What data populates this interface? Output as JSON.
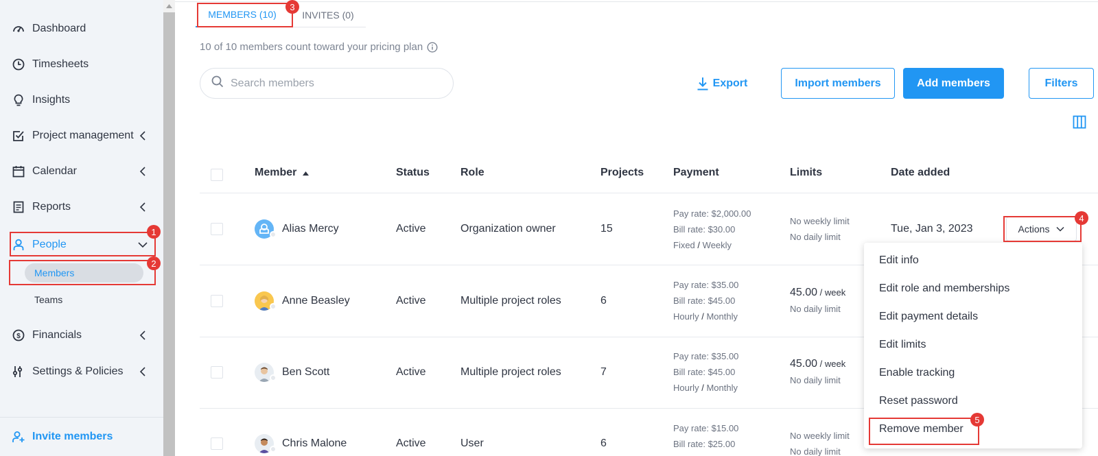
{
  "sidebar": {
    "items": [
      {
        "label": "Dashboard",
        "icon": "dashboard-icon"
      },
      {
        "label": "Timesheets",
        "icon": "clock-icon"
      },
      {
        "label": "Insights",
        "icon": "lightbulb-icon"
      },
      {
        "label": "Project management",
        "icon": "checkbox-icon"
      },
      {
        "label": "Calendar",
        "icon": "calendar-icon"
      },
      {
        "label": "Reports",
        "icon": "report-icon"
      },
      {
        "label": "People",
        "icon": "person-icon"
      },
      {
        "label": "Financials",
        "icon": "dollar-icon"
      },
      {
        "label": "Settings & Policies",
        "icon": "sliders-icon"
      }
    ],
    "people_sub": [
      "Members",
      "Teams"
    ],
    "invite_label": "Invite members"
  },
  "tabs": {
    "members": "MEMBERS (10)",
    "invites": "INVITES (0)"
  },
  "plan_note": "10 of 10 members count toward your pricing plan",
  "search": {
    "placeholder": "Search members"
  },
  "toolbar": {
    "export": "Export",
    "import": "Import members",
    "add": "Add members",
    "filters": "Filters"
  },
  "table": {
    "headers": {
      "member": "Member",
      "status": "Status",
      "role": "Role",
      "projects": "Projects",
      "payment": "Payment",
      "limits": "Limits",
      "date_added": "Date added"
    },
    "rows": [
      {
        "name": "Alias Mercy",
        "status": "Active",
        "role": "Organization owner",
        "projects": "15",
        "pay_rate": "Pay rate: $2,000.00",
        "bill_rate": "Bill rate: $30.00",
        "pay_type": "Fixed",
        "pay_period": "Weekly",
        "limit_weekly": "No weekly limit",
        "limit_weekly_unit": "",
        "limit_daily": "No daily limit",
        "date_added": "Tue, Jan 3, 2023"
      },
      {
        "name": "Anne Beasley",
        "status": "Active",
        "role": "Multiple project roles",
        "projects": "6",
        "pay_rate": "Pay rate: $35.00",
        "bill_rate": "Bill rate: $45.00",
        "pay_type": "Hourly",
        "pay_period": "Monthly",
        "limit_weekly": "45.00",
        "limit_weekly_unit": "/ week",
        "limit_daily": "No daily limit",
        "date_added": ""
      },
      {
        "name": "Ben Scott",
        "status": "Active",
        "role": "Multiple project roles",
        "projects": "7",
        "pay_rate": "Pay rate: $35.00",
        "bill_rate": "Bill rate: $45.00",
        "pay_type": "Hourly",
        "pay_period": "Monthly",
        "limit_weekly": "45.00",
        "limit_weekly_unit": "/ week",
        "limit_daily": "No daily limit",
        "date_added": ""
      },
      {
        "name": "Chris Malone",
        "status": "Active",
        "role": "User",
        "projects": "6",
        "pay_rate": "Pay rate: $15.00",
        "bill_rate": "Bill rate: $25.00",
        "pay_type": "",
        "pay_period": "",
        "limit_weekly": "No weekly limit",
        "limit_weekly_unit": "",
        "limit_daily": "No daily limit",
        "date_added": ""
      }
    ],
    "actions_label": "Actions"
  },
  "actions_menu": [
    "Edit info",
    "Edit role and memberships",
    "Edit payment details",
    "Edit limits",
    "Enable tracking",
    "Reset password",
    "Remove member"
  ],
  "annotations": [
    "1",
    "2",
    "3",
    "4",
    "5"
  ],
  "colors": {
    "accent": "#2196f3",
    "annotation": "#e53935",
    "sidebar_bg": "#f1f4f8"
  }
}
